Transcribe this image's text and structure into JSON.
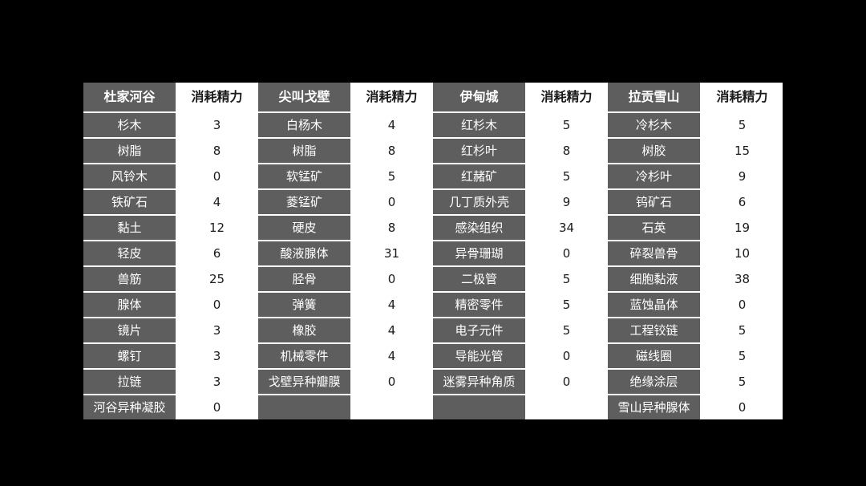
{
  "table": {
    "headers": [
      "杜家河谷",
      "消耗精力",
      "尖叫戈壁",
      "消耗精力",
      "伊甸城",
      "消耗精力",
      "拉贡雪山",
      "消耗精力"
    ],
    "rows": [
      [
        "杉木",
        "3",
        "白杨木",
        "4",
        "红杉木",
        "5",
        "冷杉木",
        "5"
      ],
      [
        "树脂",
        "8",
        "树脂",
        "8",
        "红杉叶",
        "8",
        "树胶",
        "15"
      ],
      [
        "风铃木",
        "0",
        "软锰矿",
        "5",
        "红赭矿",
        "5",
        "冷杉叶",
        "9"
      ],
      [
        "铁矿石",
        "4",
        "菱锰矿",
        "0",
        "几丁质外壳",
        "9",
        "钨矿石",
        "6"
      ],
      [
        "黏土",
        "12",
        "硬皮",
        "8",
        "感染组织",
        "34",
        "石英",
        "19"
      ],
      [
        "轻皮",
        "6",
        "酸液腺体",
        "31",
        "异骨珊瑚",
        "0",
        "碎裂兽骨",
        "10"
      ],
      [
        "兽筋",
        "25",
        "胫骨",
        "0",
        "二极管",
        "5",
        "细胞黏液",
        "38"
      ],
      [
        "腺体",
        "0",
        "弹簧",
        "4",
        "精密零件",
        "5",
        "蓝蚀晶体",
        "0"
      ],
      [
        "镜片",
        "3",
        "橡胶",
        "4",
        "电子元件",
        "5",
        "工程铰链",
        "5"
      ],
      [
        "螺钉",
        "3",
        "机械零件",
        "4",
        "导能光管",
        "0",
        "磁线圈",
        "5"
      ],
      [
        "拉链",
        "3",
        "戈壁异种瓣膜",
        "0",
        "迷雾异种角质",
        "0",
        "绝缘涂层",
        "5"
      ],
      [
        "河谷异种凝胶",
        "0",
        "",
        "",
        "",
        "",
        "雪山异种腺体",
        "0"
      ]
    ]
  },
  "colors": {
    "page_background": "#000000",
    "name_cell_background": "#5e5e5e",
    "value_cell_background": "#ffffff",
    "grid_line": "#ffffff",
    "name_text": "#ffffff",
    "value_text": "#1a1a1a"
  }
}
